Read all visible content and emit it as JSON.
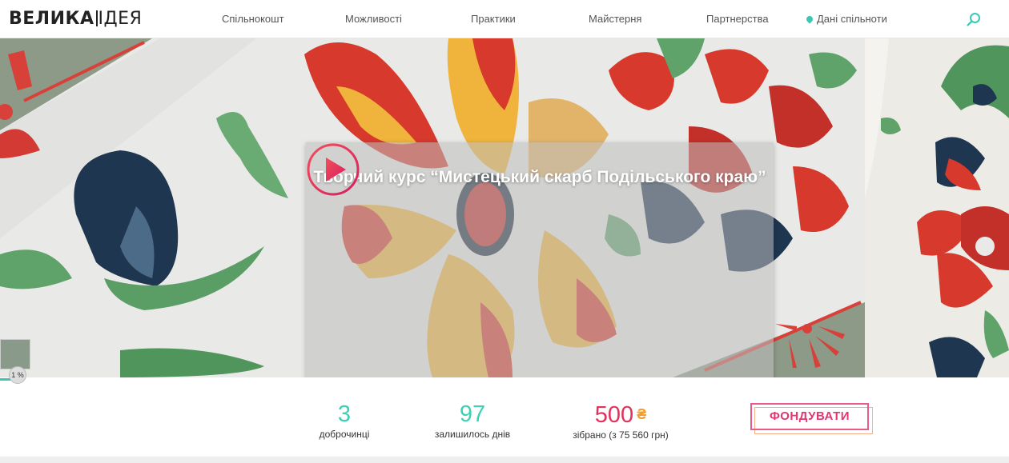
{
  "header": {
    "logo_bold": "ВЕЛИКА",
    "logo_light": "ІДЕЯ",
    "nav": [
      "Спільнокошт",
      "Можливості",
      "Практики",
      "Майстерня",
      "Партнерства",
      "Дані спільноти"
    ],
    "search_icon": "search-icon"
  },
  "hero": {
    "title": "Творчий курс “Мистецький скарб Подільського краю”",
    "play_icon": "play-icon",
    "progress_badge": "1 %"
  },
  "stats": {
    "donors_count": "3",
    "donors_label": "доброчинці",
    "days_count": "97",
    "days_label": "залишилось днів",
    "raised_amount": "500",
    "currency_symbol": "₴",
    "raised_label": "зібрано (з 75 560 грн)"
  },
  "actions": {
    "fund_label": "ФОНДУВАТИ"
  },
  "colors": {
    "accent_teal": "#3cd0b4",
    "accent_pink": "#e2325c",
    "accent_orange": "#f49a25"
  }
}
